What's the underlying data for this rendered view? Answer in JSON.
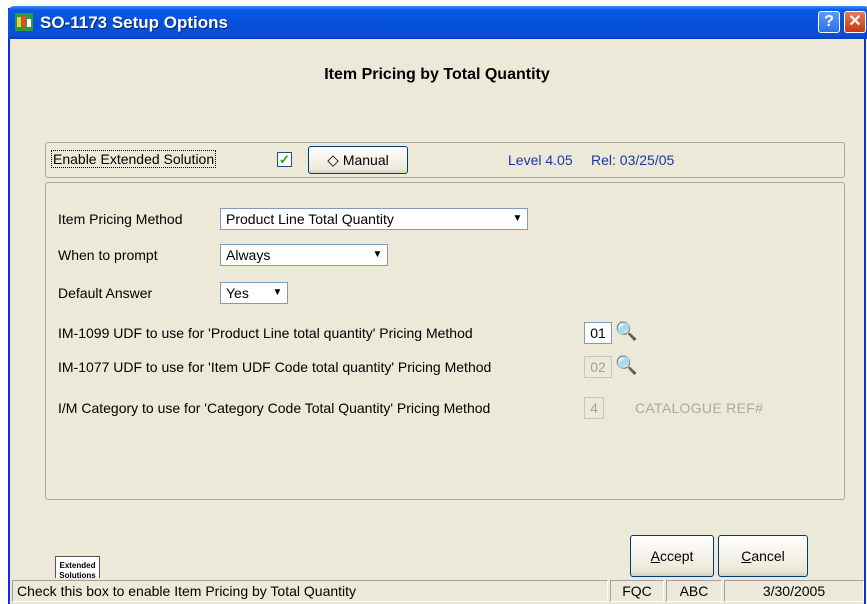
{
  "window": {
    "title": "SO-1173 Setup Options",
    "help_label": "?",
    "close_label": "✕"
  },
  "heading": "Item Pricing by Total Quantity",
  "extended": {
    "enable_label": "Enable Extended Solution",
    "enable_checked": true,
    "check_glyph": "✓",
    "manual_label": "Manual",
    "manual_icon": "◇",
    "level": "Level 4.05",
    "rel": "Rel: 03/25/05"
  },
  "options": {
    "pricing_method_label": "Item Pricing Method",
    "pricing_method_value": "Product Line Total Quantity",
    "prompt_label": "When to prompt",
    "prompt_value": "Always",
    "default_answer_label": "Default Answer",
    "default_answer_value": "Yes",
    "udf1099_label": "IM-1099 UDF to use for 'Product Line total quantity' Pricing Method",
    "udf1099_value": "01",
    "udf1077_label": "IM-1077 UDF to use for 'Item UDF Code total quantity' Pricing Method",
    "udf1077_value": "02",
    "category_label": "I/M Category to use for 'Category Code Total Quantity' Pricing Method",
    "category_value": "4",
    "category_desc": "CATALOGUE REF#"
  },
  "buttons": {
    "accept_first": "A",
    "accept_rest": "ccept",
    "cancel_first": "C",
    "cancel_rest": "ancel"
  },
  "logo": {
    "line1": "Extended",
    "line2": "Solutions"
  },
  "statusbar": {
    "message": "Check this box to enable Item Pricing by Total Quantity",
    "company": "FQC",
    "user": "ABC",
    "date": "3/30/2005"
  },
  "icons": {
    "dropdown_arrow": "▼",
    "lookup": "🔍"
  },
  "colors": {
    "titlebar": "#0551dc",
    "dialog_bg": "#ece9d8",
    "level_text": "#1a36a6",
    "check_green": "#21a121"
  }
}
